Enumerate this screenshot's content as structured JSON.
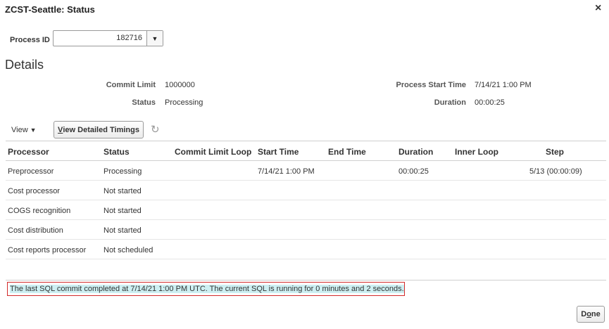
{
  "dialog": {
    "title": "ZCST-Seattle: Status",
    "close_glyph": "×"
  },
  "process": {
    "label": "Process ID",
    "value": "182716",
    "dropdown_glyph": "▼"
  },
  "details": {
    "heading": "Details",
    "commit_limit_label": "Commit Limit",
    "commit_limit_value": "1000000",
    "status_label": "Status",
    "status_value": "Processing",
    "start_time_label": "Process Start Time",
    "start_time_value": "7/14/21 1:00 PM",
    "duration_label": "Duration",
    "duration_value": "00:00:25"
  },
  "toolbar": {
    "view_label": "View",
    "view_caret": "▼",
    "detailed_mnemonic": "V",
    "detailed_rest": "iew Detailed Timings",
    "refresh_glyph": "↻"
  },
  "table": {
    "columns": [
      "Processor",
      "Status",
      "Commit Limit Loop",
      "Start Time",
      "End Time",
      "Duration",
      "Inner Loop",
      "Step"
    ],
    "rows": [
      [
        "Preprocessor",
        "Processing",
        "",
        "7/14/21 1:00 PM",
        "",
        "00:00:25",
        "",
        "5/13 (00:00:09)"
      ],
      [
        "Cost processor",
        "Not started",
        "",
        "",
        "",
        "",
        "",
        ""
      ],
      [
        "COGS recognition",
        "Not started",
        "",
        "",
        "",
        "",
        "",
        ""
      ],
      [
        "Cost distribution",
        "Not started",
        "",
        "",
        "",
        "",
        "",
        ""
      ],
      [
        "Cost reports processor",
        "Not scheduled",
        "",
        "",
        "",
        "",
        "",
        ""
      ]
    ]
  },
  "message": "The last SQL commit completed at 7/14/21 1:00 PM UTC. The current SQL is running for 0 minutes and 2 seconds.",
  "footer": {
    "done_first": "D",
    "done_mnemonic": "o",
    "done_rest": "ne"
  },
  "colors": {
    "highlight": "#cdeff2",
    "message_border": "#d22a2a"
  }
}
